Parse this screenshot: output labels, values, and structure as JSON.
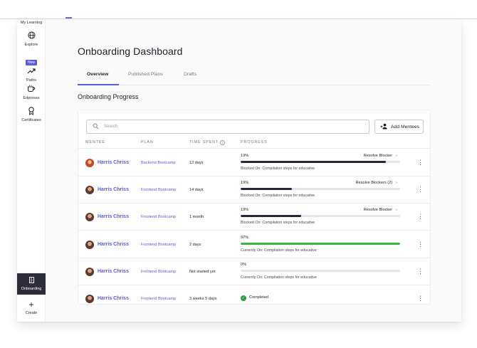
{
  "sidebar": {
    "items": [
      {
        "label": "My Learning",
        "icon": "book-icon"
      },
      {
        "label": "Explore",
        "icon": "globe-icon"
      },
      {
        "label": "Paths",
        "icon": "trend-icon",
        "badge": "New"
      },
      {
        "label": "Edpresso",
        "icon": "coffee-icon"
      },
      {
        "label": "Certificates",
        "icon": "ribbon-icon"
      },
      {
        "label": "Onboarding",
        "icon": "door-icon",
        "active": true
      },
      {
        "label": "Create",
        "icon": "plus-icon"
      }
    ]
  },
  "page": {
    "title": "Onboarding Dashboard",
    "tabs": [
      "Overview",
      "Published Plans",
      "Drafts"
    ],
    "section_title": "Onboarding Progress"
  },
  "toolbar": {
    "search_placeholder": "Search",
    "add_label": "Add Mentees"
  },
  "table": {
    "headers": [
      "MENTEE",
      "PLAN",
      "TIME SPENT",
      "PROGRESS"
    ],
    "rows": [
      {
        "mentee": "Harris Chriss",
        "plan": "Backend Bootcamp",
        "time": "12 days",
        "progress_label": "19%",
        "progress": 0.91,
        "bar_color": "#262640",
        "action": "Resolve Blocker",
        "status": "Blocked On: Compilation steps for educative"
      },
      {
        "mentee": "Harris Chriss",
        "plan": "Frontend Bootcamp",
        "time": "14 days",
        "progress_label": "19%",
        "progress": 0.32,
        "bar_color": "#262640",
        "action": "Resolve Blockers (2)",
        "status": "Blocked On: Compilation steps for educative"
      },
      {
        "mentee": "Harris Chriss",
        "plan": "Frontend Bootcamp",
        "time": "1 month",
        "progress_label": "19%",
        "progress": 0.38,
        "bar_color": "#262640",
        "action": "Resolve Blocker",
        "status": "Blocked On: Compilation steps for educative"
      },
      {
        "mentee": "Harris Chriss",
        "plan": "Frontend Bootcamp",
        "time": "2 days",
        "progress_label": "97%",
        "progress": 1.0,
        "bar_color": "#3bb73b",
        "action": "",
        "status": "Currently On: Compilation steps for educative"
      },
      {
        "mentee": "Harris Chriss",
        "plan": "Frontend Bootcamp",
        "time": "Not started yet",
        "progress_label": "0%",
        "progress": 0.0,
        "bar_color": "#262640",
        "action": "",
        "status": "Currently On: Compilation steps for educative"
      },
      {
        "mentee": "Harris Chriss",
        "plan": "Frontend Bootcamp",
        "time": "3 weeks 5 days",
        "progress_label": "",
        "progress": null,
        "bar_color": "",
        "action": "",
        "status": "",
        "completed": "Completed"
      }
    ]
  },
  "colors": {
    "accent": "#5b5bdc",
    "dark": "#2c2c3a",
    "success": "#2a9d3f"
  }
}
